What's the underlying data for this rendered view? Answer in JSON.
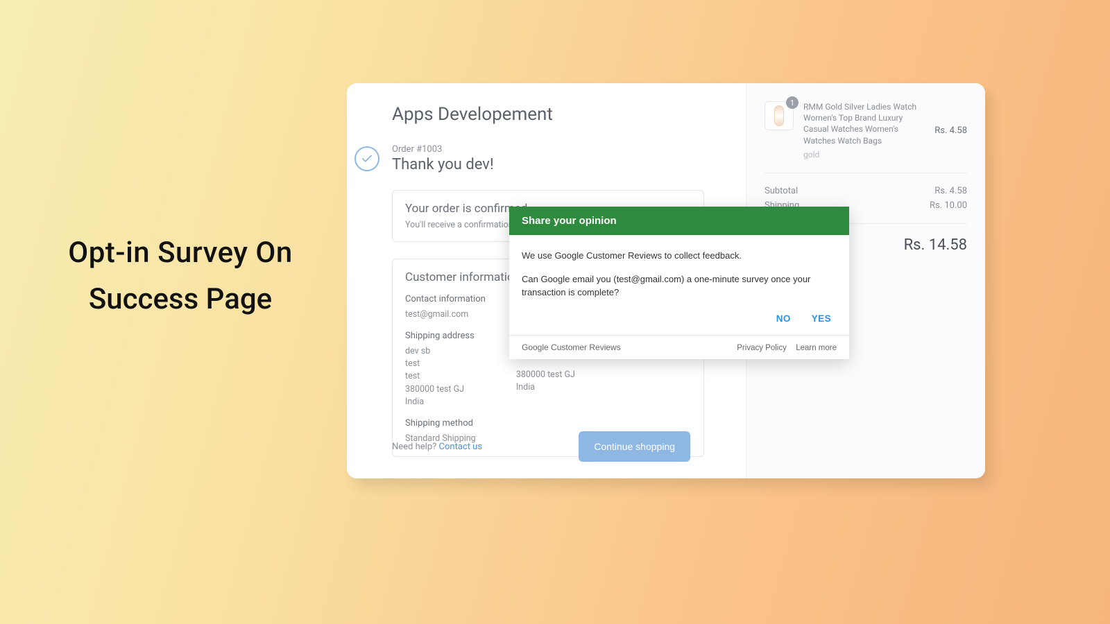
{
  "caption": {
    "line1": "Opt-in Survey On",
    "line2": "Success Page"
  },
  "store": {
    "name": "Apps Developement"
  },
  "order": {
    "number": "Order #1003",
    "thank_you": "Thank you dev!"
  },
  "confirm_panel": {
    "title": "Your order is confirmed",
    "subtitle": "You'll receive a confirmation email"
  },
  "customer_info": {
    "title": "Customer information",
    "contact_label": "Contact information",
    "contact_value": "test@gmail.com",
    "shipping_addr_label": "Shipping address",
    "shipping_addr": "dev sb\ntest\ntest\n380000 test GJ\nIndia",
    "billing_addr": "380000 test GJ\nIndia",
    "shipping_method_label": "Shipping method",
    "shipping_method_value": "Standard Shipping"
  },
  "footer": {
    "need_help": "Need help?",
    "contact_us": "Contact us",
    "continue": "Continue shopping"
  },
  "summary": {
    "product": {
      "qty": "1",
      "title": "RMM Gold Silver Ladies Watch Women's Top Brand Luxury Casual Watches Women's Watches Watch Bags",
      "variant": "gold",
      "price": "Rs. 4.58"
    },
    "subtotal_label": "Subtotal",
    "subtotal_value": "Rs. 4.58",
    "shipping_label": "Shipping",
    "shipping_value": "Rs. 10.00",
    "total_value": "Rs. 14.58"
  },
  "survey": {
    "header": "Share your opinion",
    "line1": "We use Google Customer Reviews to collect feedback.",
    "line2": "Can Google email you (test@gmail.com) a one-minute survey once your transaction is complete?",
    "no": "NO",
    "yes": "YES",
    "brand": "Google Customer Reviews",
    "privacy": "Privacy Policy",
    "learn": "Learn more"
  }
}
